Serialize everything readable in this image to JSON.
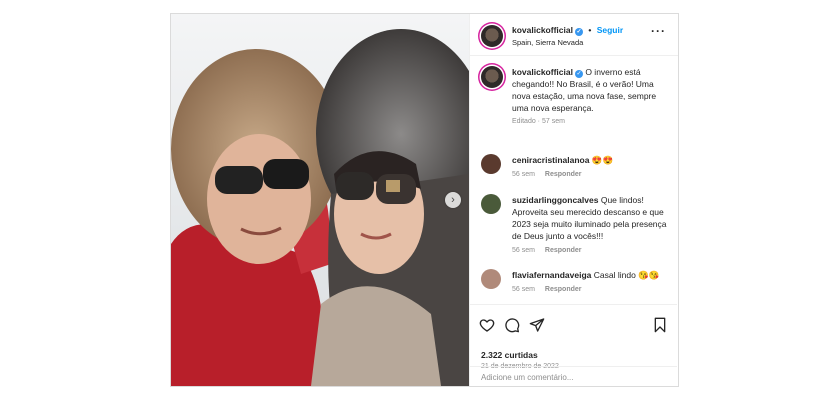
{
  "post": {
    "username": "kovalickofficial",
    "follow_label": "Seguir",
    "location": "Spain, Sierra Nevada",
    "more_icon": "more-horizontal-icon"
  },
  "caption": {
    "username": "kovalickofficial",
    "text": "O inverno está chegando!! No Brasil, é o verão! Uma nova estação, uma nova fase, sempre uma nova esperança.",
    "edited": "Editado · 57 sem"
  },
  "comments": [
    {
      "username": "ceniracristinalanoa",
      "text": "😍😍",
      "age": "56 sem",
      "reply": "Responder",
      "avatar_color": "#5a3a2e"
    },
    {
      "username": "suzidarlinggoncalves",
      "text": "Que lindos! Aproveita seu merecido descanso e que 2023 seja muito iluminado pela presença de Deus junto a vocês!!!",
      "age": "56 sem",
      "reply": "Responder",
      "avatar_color": "#4a5a3a"
    },
    {
      "username": "flaviafernandaveiga",
      "text": "Casal lindo 😘😘",
      "age": "56 sem",
      "reply": "Responder",
      "avatar_color": "#b08a7a"
    }
  ],
  "stats": {
    "likes": "2.322 curtidas",
    "date": "21 de dezembro de 2022"
  },
  "add_comment": {
    "placeholder": "Adicione um comentário..."
  },
  "colors": {
    "link_blue": "#0095f6",
    "muted": "#8e8e8e",
    "border": "#dbdbdb",
    "jacket_red": "#c4282e"
  }
}
